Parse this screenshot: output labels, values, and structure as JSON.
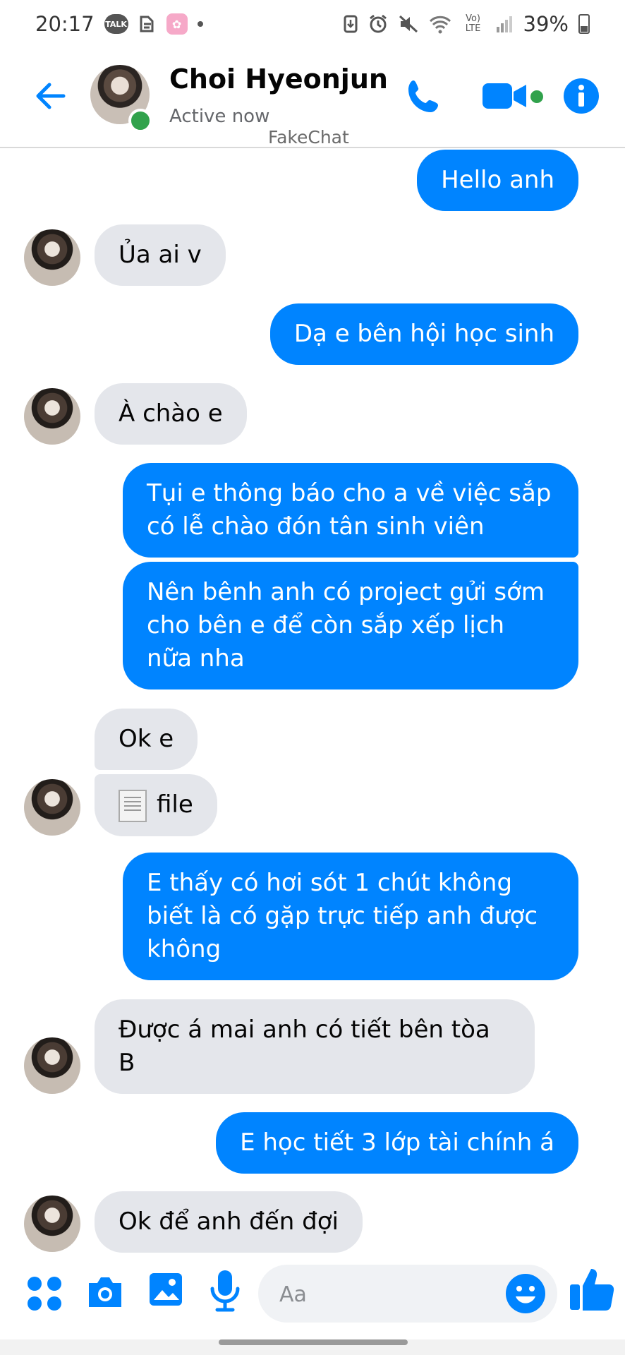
{
  "status_bar": {
    "time": "20:17",
    "talk_icon_label": "TALK",
    "battery": "39%",
    "network": "Vo) LTE"
  },
  "header": {
    "name": "Choi Hyeonjun",
    "status": "Active now",
    "watermark": "FakeChat"
  },
  "messages": [
    {
      "side": "out",
      "text": "Hello anh"
    },
    {
      "side": "in",
      "text": "Ủa ai v"
    },
    {
      "side": "out",
      "text": "Dạ e bên hội học sinh"
    },
    {
      "side": "in",
      "text": "À chào e"
    },
    {
      "side": "out",
      "text": "Tụi e thông báo cho a về việc sắp có lễ chào đón tân sinh viên"
    },
    {
      "side": "out",
      "text": "Nên bênh anh có project gửi sớm cho bên e để còn sắp xếp lịch nữa nha"
    },
    {
      "side": "in",
      "text": "Ok e"
    },
    {
      "side": "in",
      "text": "file"
    },
    {
      "side": "out",
      "text": "E thấy có hơi sót 1 chút không biết là có gặp trực tiếp anh được không"
    },
    {
      "side": "in",
      "text": "Được á mai anh có tiết bên tòa B"
    },
    {
      "side": "out",
      "text": "E học tiết 3 lớp tài chính á"
    },
    {
      "side": "in",
      "text": "Ok để anh đến đợi"
    }
  ],
  "composer": {
    "placeholder": "Aa"
  },
  "colors": {
    "accent": "#0084ff",
    "incoming_bubble": "#e4e6eb",
    "online": "#31a24c"
  }
}
